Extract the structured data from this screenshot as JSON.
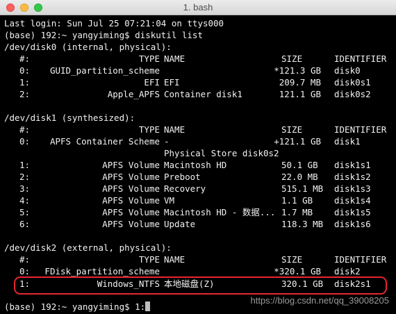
{
  "window": {
    "title": "1. bash"
  },
  "terminal": {
    "last_login": "Last login: Sun Jul 25 07:21:04 on ttys000",
    "prompt_command": "(base) 192:~ yangyiming$ diskutil list",
    "disk0": {
      "header": "/dev/disk0 (internal, physical):",
      "columns": {
        "num": "#:",
        "type": "TYPE",
        "name": "NAME",
        "size": "SIZE",
        "id": "IDENTIFIER"
      },
      "rows": [
        {
          "num": "0:",
          "type": "GUID_partition_scheme",
          "name": "",
          "size": "*121.3 GB",
          "id": "disk0"
        },
        {
          "num": "1:",
          "type": "EFI",
          "name": "EFI",
          "size": "209.7 MB",
          "id": "disk0s1"
        },
        {
          "num": "2:",
          "type": "Apple_APFS",
          "name": "Container disk1",
          "size": "121.1 GB",
          "id": "disk0s2"
        }
      ]
    },
    "disk1": {
      "header": "/dev/disk1 (synthesized):",
      "columns": {
        "num": "#:",
        "type": "TYPE",
        "name": "NAME",
        "size": "SIZE",
        "id": "IDENTIFIER"
      },
      "row0": {
        "num": "0:",
        "type": "APFS Container Scheme",
        "name": "-",
        "size": "+121.1 GB",
        "id": "disk1"
      },
      "row0_continuation": "Physical Store disk0s2",
      "rows": [
        {
          "num": "1:",
          "type": "APFS Volume",
          "name": "Macintosh HD",
          "size": "50.1 GB",
          "id": "disk1s1"
        },
        {
          "num": "2:",
          "type": "APFS Volume",
          "name": "Preboot",
          "size": "22.0 MB",
          "id": "disk1s2"
        },
        {
          "num": "3:",
          "type": "APFS Volume",
          "name": "Recovery",
          "size": "515.1 MB",
          "id": "disk1s3"
        },
        {
          "num": "4:",
          "type": "APFS Volume",
          "name": "VM",
          "size": "1.1 GB",
          "id": "disk1s4"
        },
        {
          "num": "5:",
          "type": "APFS Volume",
          "name": "Macintosh HD - 数据...",
          "size": "1.7 MB",
          "id": "disk1s5"
        },
        {
          "num": "6:",
          "type": "APFS Volume",
          "name": "Update",
          "size": "118.3 MB",
          "id": "disk1s6"
        }
      ]
    },
    "disk2": {
      "header": "/dev/disk2 (external, physical):",
      "columns": {
        "num": "#:",
        "type": "TYPE",
        "name": "NAME",
        "size": "SIZE",
        "id": "IDENTIFIER"
      },
      "rows": [
        {
          "num": "0:",
          "type": "FDisk_partition_scheme",
          "name": "",
          "size": "*320.1 GB",
          "id": "disk2"
        },
        {
          "num": "1:",
          "type": "Windows_NTFS",
          "name": "本地磁盘(Z)",
          "size": "320.1 GB",
          "id": "disk2s1"
        }
      ]
    },
    "final_prompt": "(base) 192:~ yangyiming$ 1:"
  },
  "watermark": "https://blog.csdn.net/qq_39008205",
  "colors": {
    "background": "#000000",
    "text": "#f2f2f2",
    "highlight": "#e8262f"
  }
}
